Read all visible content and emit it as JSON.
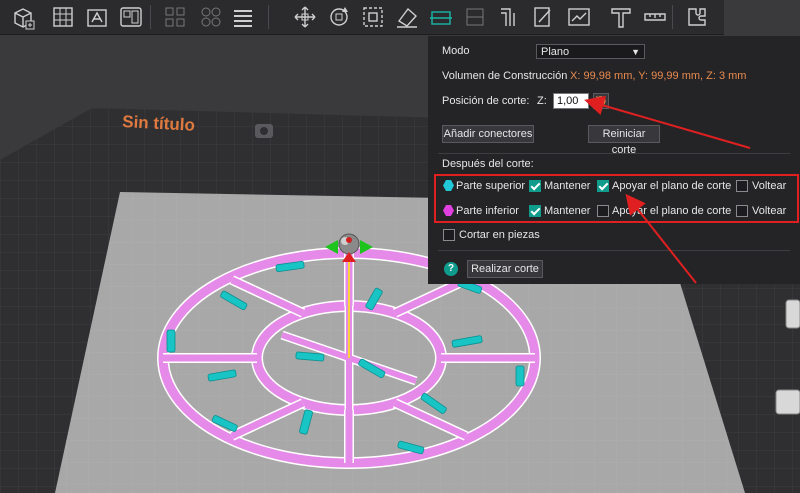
{
  "scene": {
    "plate_title": "Sin título"
  },
  "toolbar": {
    "icons": [
      "add-cube-icon",
      "grid-icon",
      "arrange-icon",
      "layout-icon",
      "split-objects-icon",
      "split-parts-icon",
      "layers-icon",
      "move-icon",
      "rotate-icon",
      "scale-icon",
      "lay-on-face-icon",
      "cut-icon",
      "variable-layer-icon",
      "support-paint-icon",
      "seam-paint-icon",
      "color-paint-icon",
      "text-icon",
      "measure-icon",
      "assembly-icon"
    ]
  },
  "cut_panel": {
    "mode_label": "Modo",
    "mode_value": "Plano",
    "build_volume_label": "Volumen de Construcción",
    "build_volume_value": "X: 99,98 mm,  Y: 99,99 mm,  Z: 3 mm",
    "cut_position_label": "Posición de corte:",
    "z_label": "Z:",
    "z_value": "1,00",
    "add_connectors_button": "Añadir conectores",
    "reset_cut_button": "Reiniciar corte",
    "after_cut_label": "Después del corte:",
    "upper_part": {
      "label": "Parte superior",
      "color": "#20c8d8",
      "keep_label": "Mantener",
      "keep_checked": true,
      "place_on_cut_label": "Apoyar el plano de corte",
      "place_on_cut_checked": true,
      "flip_label": "Voltear",
      "flip_checked": false
    },
    "lower_part": {
      "label": "Parte inferior",
      "color": "#e040e0",
      "keep_label": "Mantener",
      "keep_checked": true,
      "place_on_cut_label": "Apoyar el plano de corte",
      "place_on_cut_checked": false,
      "flip_label": "Voltear",
      "flip_checked": false
    },
    "cut_into_pieces_label": "Cortar en piezas",
    "cut_into_pieces_checked": false,
    "help_icon": "?",
    "perform_cut_button": "Realizar corte"
  },
  "colors": {
    "accent": "#0f9c8c",
    "annotation": "#e02020",
    "model": "#e58ae8",
    "cut_marks": "#18c4c4"
  }
}
